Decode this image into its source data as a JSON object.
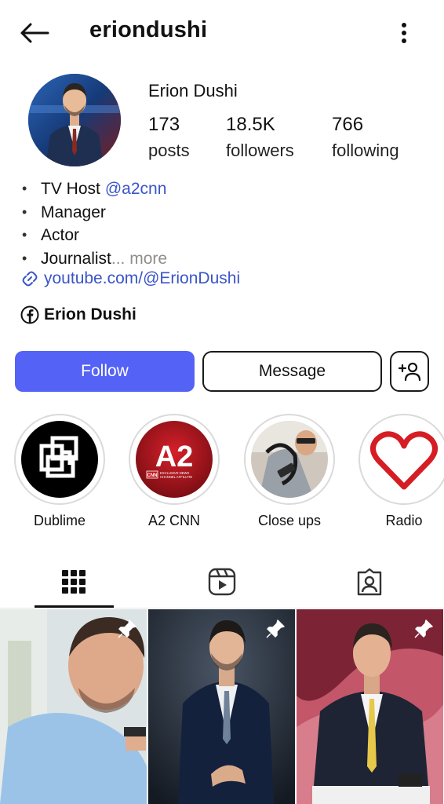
{
  "header": {
    "username": "eriondushi",
    "back_icon": "back-arrow-icon",
    "menu_icon": "more-vertical-icon"
  },
  "profile": {
    "full_name": "Erion Dushi",
    "stats": {
      "posts": {
        "value": "173",
        "label": "posts"
      },
      "followers": {
        "value": "18.5K",
        "label": "followers"
      },
      "following": {
        "value": "766",
        "label": "following"
      }
    },
    "bio": {
      "line1_prefix": "TV Host",
      "line1_mention": "@a2cnn",
      "line2": "Manager",
      "line3": "Actor",
      "line4": "Journalist",
      "more": "... more"
    },
    "link": "youtube.com/@ErionDushi",
    "facebook_name": "Erion Dushi"
  },
  "actions": {
    "follow": "Follow",
    "message": "Message"
  },
  "highlights": [
    {
      "label": "Dublime"
    },
    {
      "label": "A2 CNN",
      "logo_text": "A2",
      "sub_text": "EXCLUSIVE NEWS CHANNEL AFFILIATE"
    },
    {
      "label": "Close ups"
    },
    {
      "label": "Radio"
    }
  ],
  "tabs": [
    {
      "name": "posts",
      "icon": "grid-icon"
    },
    {
      "name": "reels",
      "icon": "reels-icon"
    },
    {
      "name": "tagged",
      "icon": "tagged-icon"
    }
  ],
  "colors": {
    "accent": "#5462f6",
    "link": "#3a55c7",
    "muted": "#8e8e8e"
  }
}
